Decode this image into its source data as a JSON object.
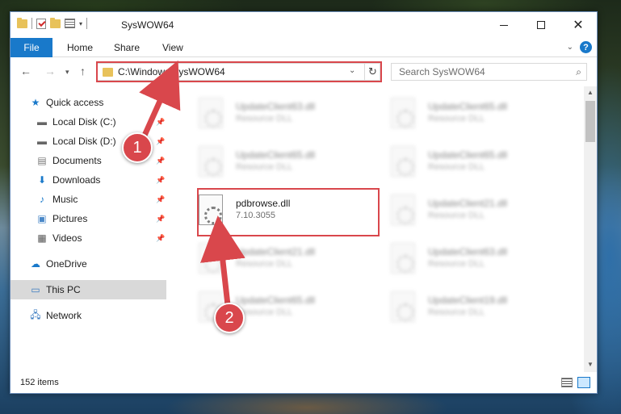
{
  "window": {
    "title": "SysWOW64",
    "minimize_icon": "minimize-icon",
    "maximize_icon": "maximize-icon",
    "close_glyph": "✕"
  },
  "ribbon": {
    "file": "File",
    "home": "Home",
    "share": "Share",
    "view": "View",
    "help_glyph": "?"
  },
  "address_bar": {
    "path": "C:\\Windows\\SysWOW64",
    "search_placeholder": "Search SysWOW64"
  },
  "nav_pane": {
    "items": [
      {
        "label": "Quick access",
        "icon": "star-icon"
      },
      {
        "label": "Local Disk (C:)",
        "icon": "drive-icon"
      },
      {
        "label": "Local Disk (D:)",
        "icon": "drive-icon"
      },
      {
        "label": "Documents",
        "icon": "documents-icon"
      },
      {
        "label": "Downloads",
        "icon": "download-icon"
      },
      {
        "label": "Music",
        "icon": "music-icon"
      },
      {
        "label": "Pictures",
        "icon": "pictures-icon"
      },
      {
        "label": "Videos",
        "icon": "videos-icon"
      },
      {
        "label": "OneDrive",
        "icon": "cloud-icon"
      },
      {
        "label": "This PC",
        "icon": "monitor-icon"
      },
      {
        "label": "Network",
        "icon": "network-icon"
      }
    ]
  },
  "files": [
    {
      "name": "UpdateClient63.dll",
      "sub": "Resource DLL"
    },
    {
      "name": "UpdateClient65.dll",
      "sub": "Resource DLL"
    },
    {
      "name": "UpdateClient65.dll",
      "sub": "Resource DLL"
    },
    {
      "name": "UpdateClient65.dll",
      "sub": "Resource DLL"
    },
    {
      "name": "pdbrowse.dll",
      "sub": "7.10.3055"
    },
    {
      "name": "UpdateClient21.dll",
      "sub": "Resource DLL"
    },
    {
      "name": "UpdateClient21.dll",
      "sub": "Resource DLL"
    },
    {
      "name": "UpdateClient63.dll",
      "sub": "Resource DLL"
    },
    {
      "name": "UpdateClient65.dll",
      "sub": "Resource DLL"
    },
    {
      "name": "UpdateClient19.dll",
      "sub": "Resource DLL"
    }
  ],
  "status": {
    "count": "152 items"
  },
  "callouts": {
    "one": "1",
    "two": "2"
  },
  "colors": {
    "accent": "#1979ca",
    "highlight": "#d9474c"
  }
}
